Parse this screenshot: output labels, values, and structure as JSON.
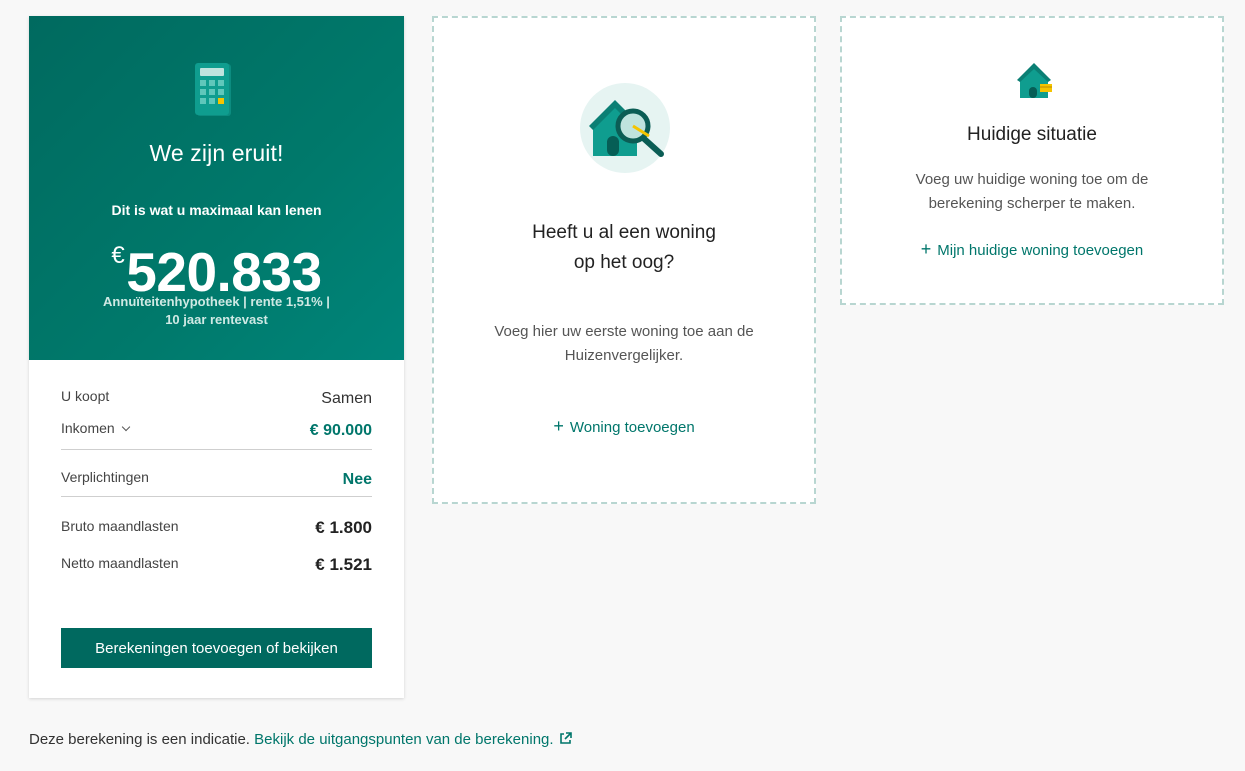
{
  "summary": {
    "title": "We zijn eruit!",
    "subtitle": "Dit is wat u maximaal kan lenen",
    "currency": "€",
    "amount": "520.833",
    "details_line1": "Annuïteitenhypotheek | rente 1,51% |",
    "details_line2": "10 jaar rentevast",
    "rows": {
      "koopt": {
        "label": "U koopt",
        "value": "Samen"
      },
      "inkomen": {
        "label": "Inkomen",
        "value": "€ 90.000"
      },
      "verplichtingen": {
        "label": "Verplichtingen",
        "value": "Nee"
      },
      "bruto": {
        "label": "Bruto maandlasten",
        "value": "€ 1.800"
      },
      "netto": {
        "label": "Netto maandlasten",
        "value": "€ 1.521"
      }
    },
    "button_label": "Berekeningen toevoegen of bekijken"
  },
  "house_card": {
    "title_line1": "Heeft u al een woning",
    "title_line2": "op het oog?",
    "text_line1": "Voeg hier uw eerste woning toe aan de",
    "text_line2": "Huizenvergelijker.",
    "link_label": "Woning toevoegen",
    "icon": "house-search-icon"
  },
  "current_card": {
    "title": "Huidige situatie",
    "text_line1": "Voeg uw huidige woning toe om de",
    "text_line2": "berekening scherper te maken.",
    "link_label": "Mijn huidige woning toevoegen",
    "icon": "house-wallet-icon"
  },
  "footer": {
    "note": "Deze berekening is een indicatie.",
    "link": "Bekijk de uitgangspunten van de berekening."
  },
  "colors": {
    "primary": "#00695f",
    "accent": "#00766b",
    "dashed_border": "#b8d6d1",
    "background": "#f8f8f8"
  }
}
